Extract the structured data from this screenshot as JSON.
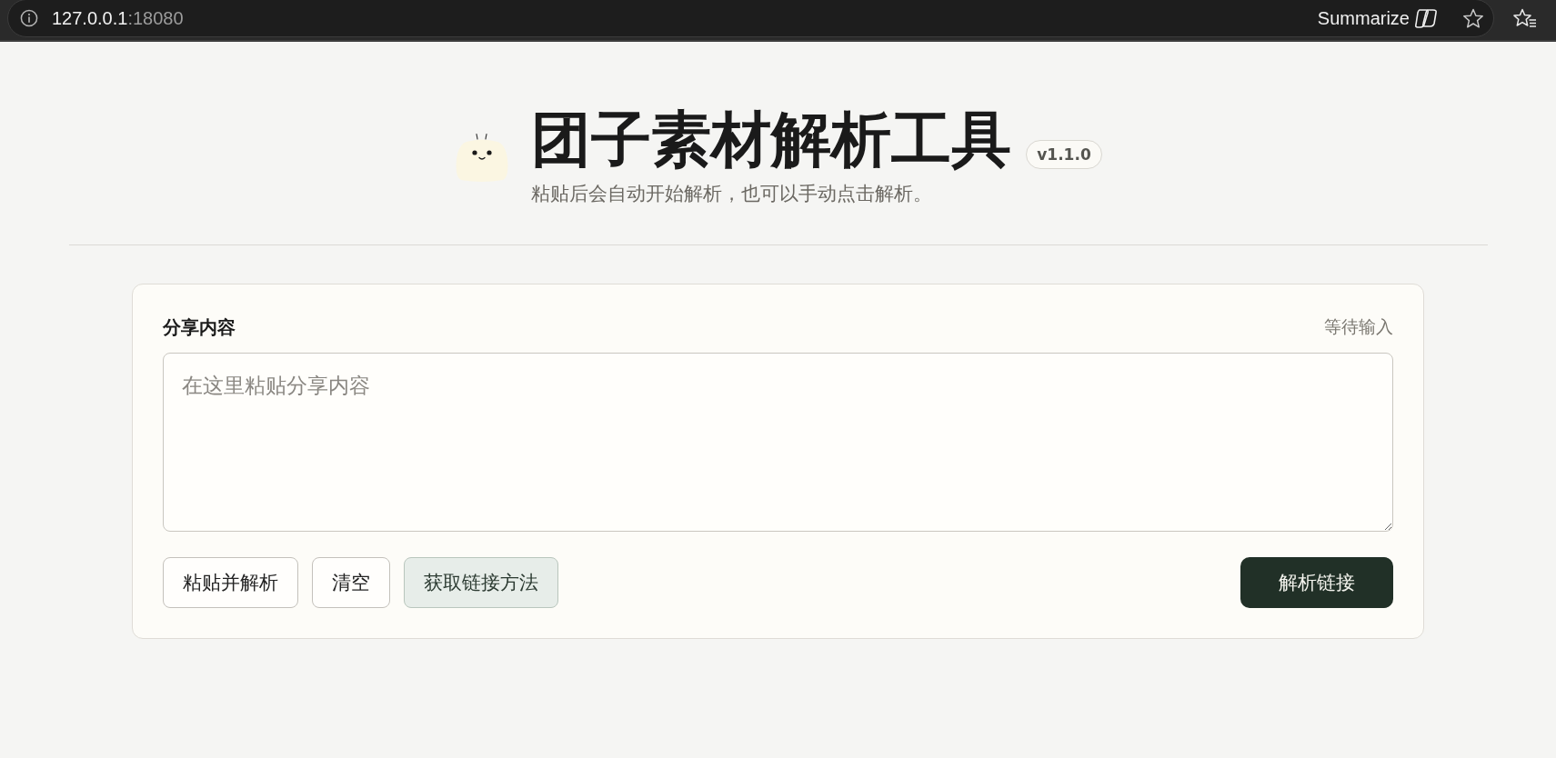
{
  "browser": {
    "url_host": "127.0.0.1",
    "url_port": ":18080",
    "summarize_label": "Summarize"
  },
  "header": {
    "title": "团子素材解析工具",
    "version": "v1.1.0",
    "subtitle": "粘贴后会自动开始解析，也可以手动点击解析。"
  },
  "card": {
    "label": "分享内容",
    "status": "等待输入",
    "input": {
      "placeholder": "在这里粘贴分享内容"
    },
    "actions": [
      {
        "label": "粘贴并解析",
        "kind": "plain"
      },
      {
        "label": "清空",
        "kind": "plain"
      },
      {
        "label": "获取链接方法",
        "kind": "tinted"
      }
    ],
    "submit": {
      "label": "解析链接"
    }
  }
}
